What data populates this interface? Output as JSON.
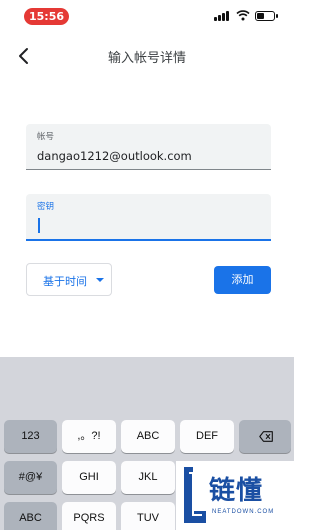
{
  "status_bar": {
    "time": "15:56",
    "battery_level": 0.45
  },
  "header": {
    "title": "输入帐号详情",
    "back_icon": "chevron-left-icon"
  },
  "form": {
    "account": {
      "label": "帐号",
      "value": "dangao1212@outlook.com"
    },
    "key": {
      "label": "密钥",
      "value": ""
    },
    "key_type": {
      "selected": "基于时间"
    },
    "add_label": "添加"
  },
  "keyboard": {
    "rows": [
      [
        "123",
        ",。?!",
        "ABC",
        "DEF",
        "delete"
      ],
      [
        "#@¥",
        "GHI",
        "JKL"
      ],
      [
        "ABC",
        "PQRS",
        "TUV"
      ]
    ]
  },
  "watermark": {
    "text": "链懂",
    "sub": "NEATDOWN.COM"
  },
  "colors": {
    "accent": "#1a73e8",
    "time_pill": "#e53935",
    "keyboard_bg": "#d3d5db"
  }
}
